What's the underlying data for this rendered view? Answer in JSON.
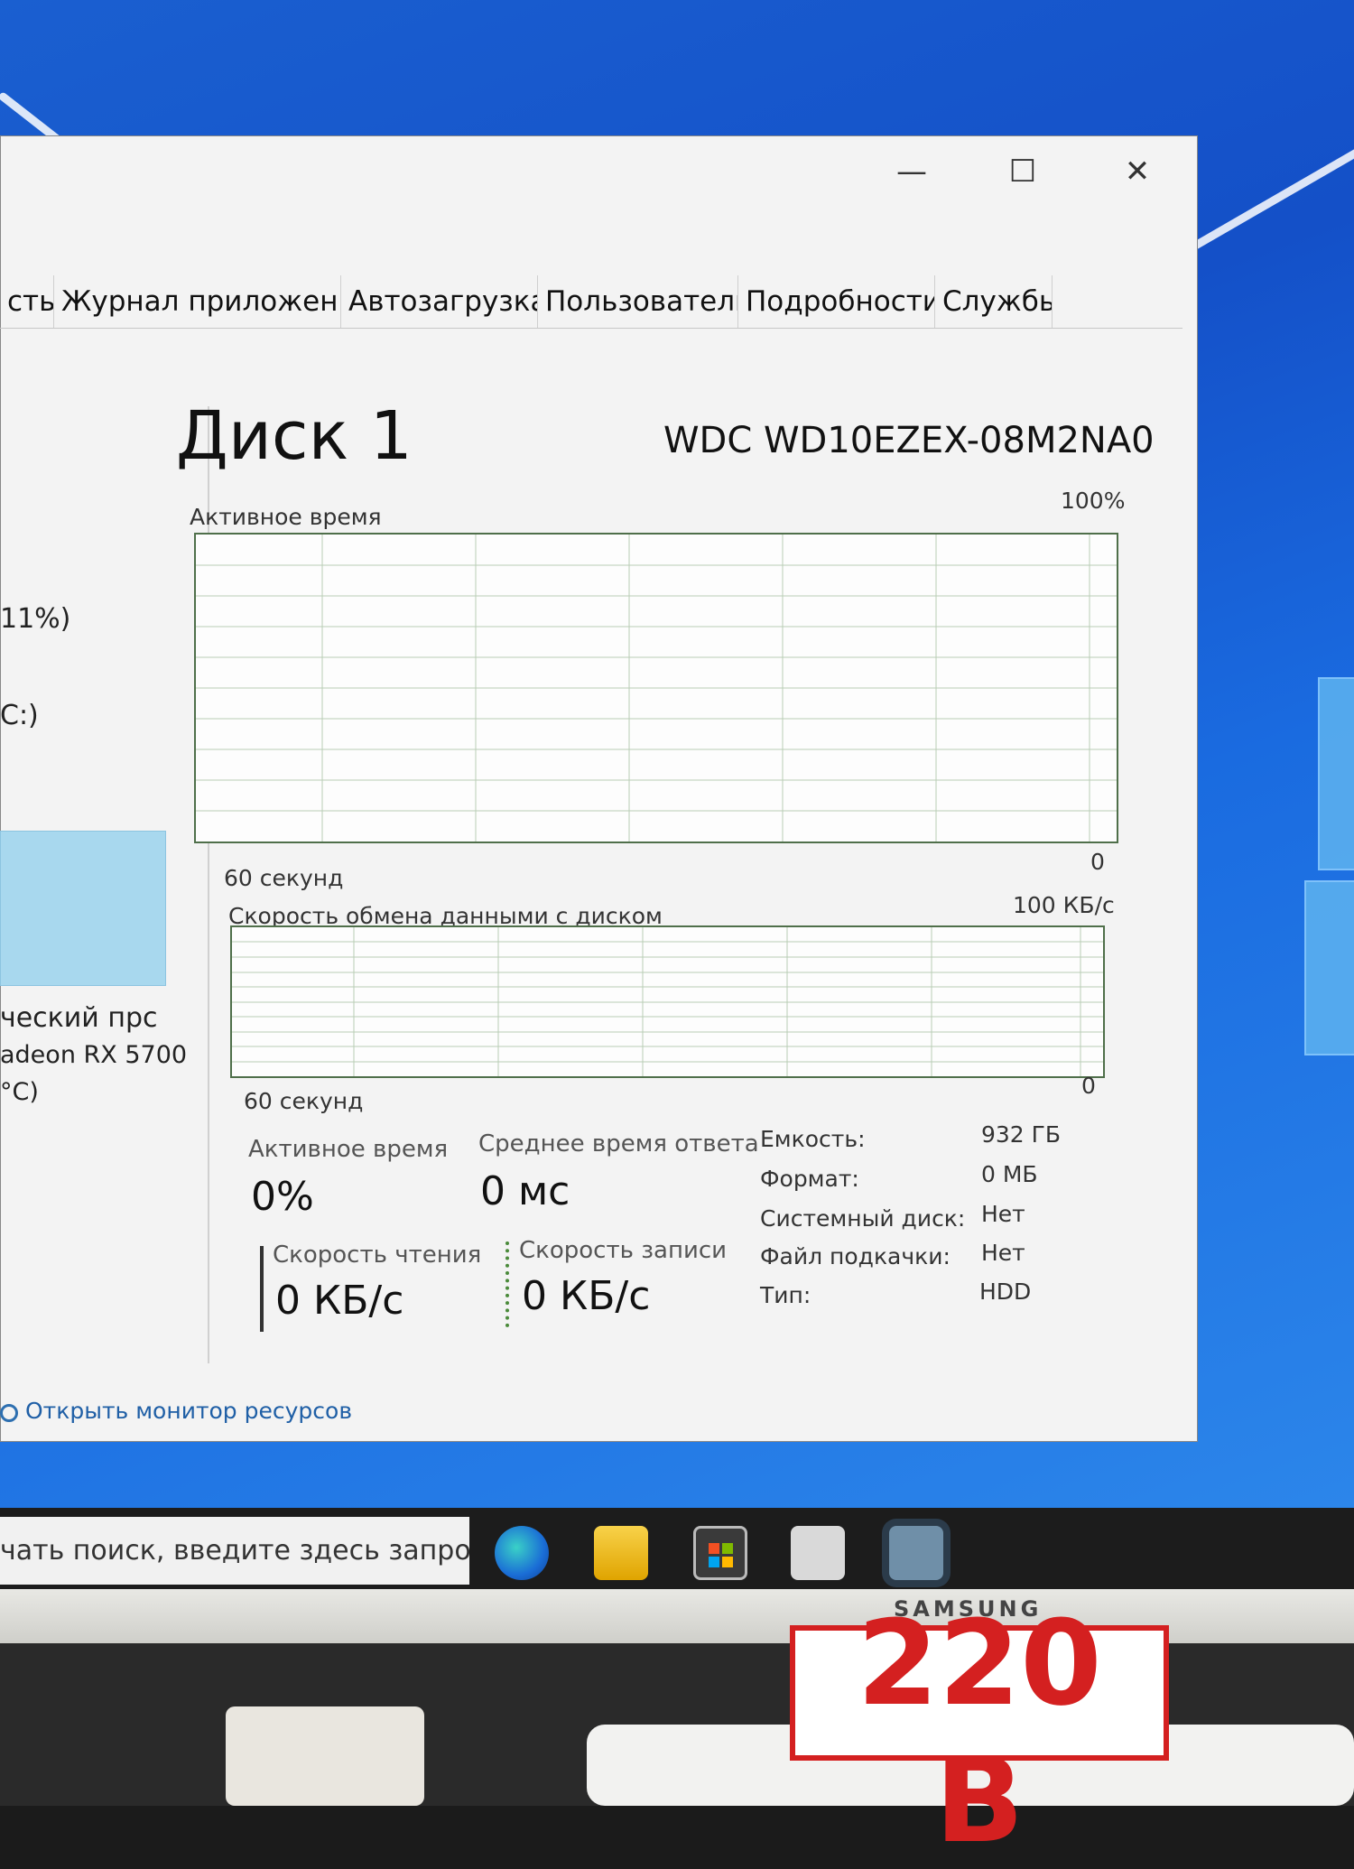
{
  "window": {
    "controls": {
      "minimize": "—",
      "maximize": "☐",
      "close": "✕"
    },
    "tabs": [
      "сть",
      "Журнал приложений",
      "Автозагрузка",
      "Пользователи",
      "Подробности",
      "Службы"
    ]
  },
  "sidebar": {
    "items": [
      "11%)",
      "C:)",
      "ческий прс",
      "adeon RX 5700",
      "°C)"
    ]
  },
  "disk": {
    "title": "Диск 1",
    "model": "WDC WD10EZEX-08M2NA0",
    "active_graph": {
      "label": "Активное время",
      "max": "100%",
      "min": "0",
      "time": "60 секунд"
    },
    "transfer_graph": {
      "label": "Скорость обмена данными с диском",
      "max": "100 КБ/с",
      "min": "0",
      "time": "60 секунд"
    },
    "stats": {
      "active_time_label": "Активное время",
      "active_time_value": "0%",
      "response_label": "Среднее время ответа",
      "response_value": "0 мс",
      "read_label": "Скорость чтения",
      "read_value": "0 КБ/с",
      "write_label": "Скорость записи",
      "write_value": "0 КБ/с"
    },
    "properties": [
      {
        "key": "Емкость:",
        "value": "932 ГБ"
      },
      {
        "key": "Формат:",
        "value": "0 МБ"
      },
      {
        "key": "Системный диск:",
        "value": "Нет"
      },
      {
        "key": "Файл подкачки:",
        "value": "Нет"
      },
      {
        "key": "Тип:",
        "value": "HDD"
      }
    ]
  },
  "footer": {
    "resource_monitor": "Открыть монитор ресурсов"
  },
  "taskbar": {
    "search_placeholder": "чать поиск, введите здесь запрос",
    "icons": [
      "edge-icon",
      "file-explorer-icon",
      "store-icon",
      "mail-icon",
      "task-manager-icon"
    ]
  },
  "monitor": {
    "brand": "SAMSUNG"
  },
  "sign": {
    "text": "220 В"
  }
}
